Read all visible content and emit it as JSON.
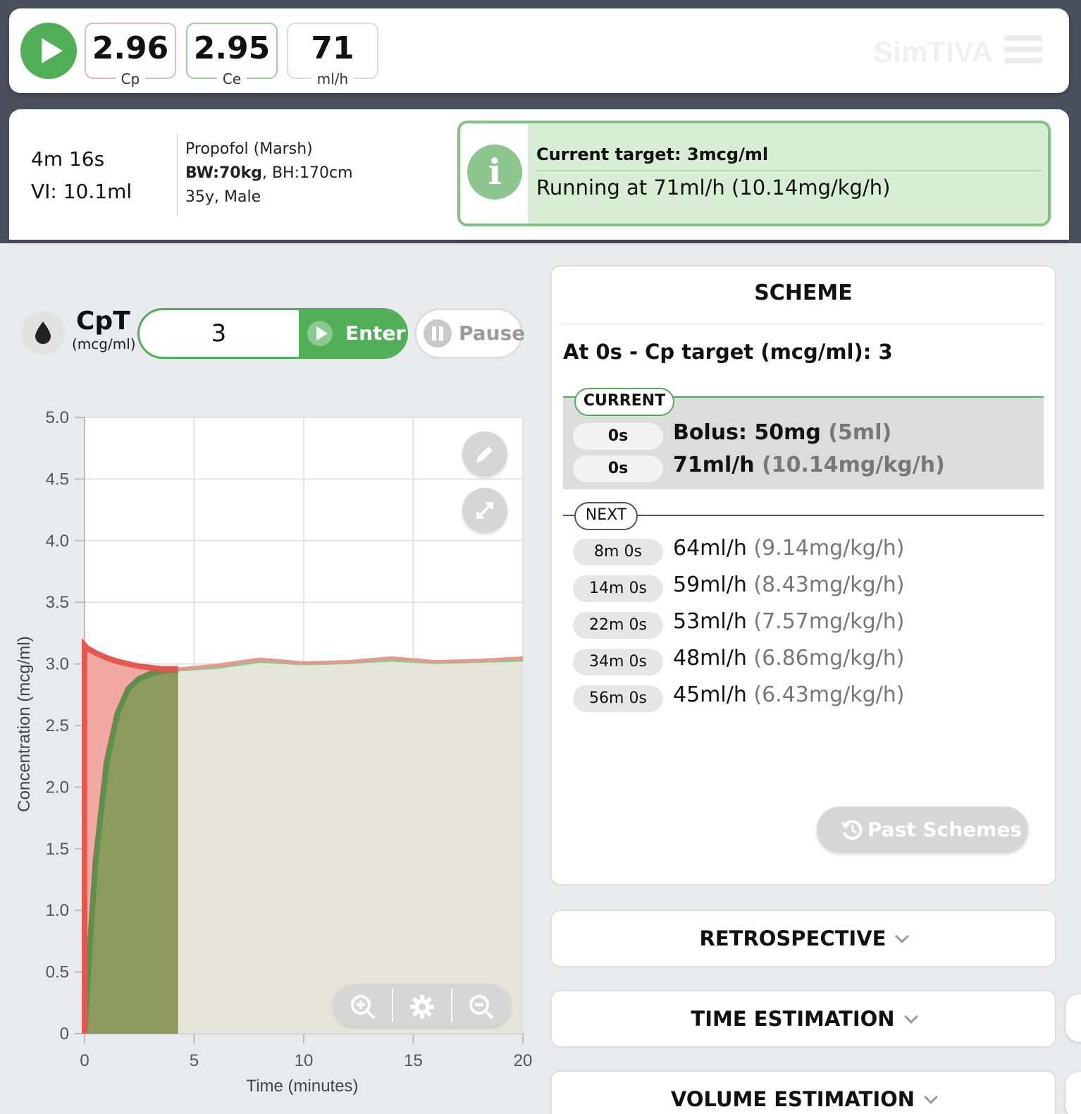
{
  "topbar": {
    "cp": {
      "value": "2.96",
      "unit": "Cp"
    },
    "ce": {
      "value": "2.95",
      "unit": "Ce"
    },
    "rate": {
      "value": "71",
      "unit": "ml/h"
    },
    "brand": "SimTIVA",
    "icons": {
      "play": "play-icon",
      "menu": "hamburger-menu-icon"
    }
  },
  "status": {
    "elapsed": "4m 16s",
    "volume": "VI: 10.1ml",
    "drug": "Propofol (Marsh)",
    "bw": "BW:70kg",
    "bh": ", BH:170cm",
    "demo": "35y, Male"
  },
  "alert": {
    "title": "Current target: 3mcg/ml",
    "message": "Running at 71ml/h (10.14mg/kg/h)",
    "icon": "info-icon",
    "color": "#d7eed4"
  },
  "control": {
    "label": "CpT",
    "unit": "(mcg/ml)",
    "target_value": "3",
    "enter_label": "Enter",
    "pause_label": "Pause",
    "accent": "#4fae56"
  },
  "chart_data": {
    "type": "line",
    "xlabel": "Time (minutes)",
    "ylabel": "Concentration (mcg/ml)",
    "xlim": [
      0,
      20
    ],
    "ylim": [
      0,
      5
    ],
    "xticks": [
      "0",
      "5",
      "10",
      "15",
      "20"
    ],
    "yticks": [
      "0",
      "0.5",
      "1.0",
      "1.5",
      "2.0",
      "2.5",
      "3.0",
      "3.5",
      "4.0",
      "4.5",
      "5.0"
    ],
    "grid": true,
    "current_time_min": 4.27,
    "series": [
      {
        "color": "#e8574e",
        "x": [
          0,
          0.1,
          0.5,
          1,
          1.5,
          2,
          2.5,
          3,
          3.5,
          4,
          4.27,
          6,
          8,
          10,
          12,
          14,
          16,
          18,
          20
        ],
        "y": [
          3.15,
          3.13,
          3.09,
          3.05,
          3.02,
          3.0,
          2.98,
          2.97,
          2.96,
          2.96,
          2.96,
          2.99,
          3.04,
          3.01,
          3.02,
          3.05,
          3.02,
          3.03,
          3.05
        ]
      },
      {
        "color": "#5aa35f",
        "x": [
          0,
          0.2,
          0.5,
          1,
          1.5,
          2,
          2.5,
          3,
          3.5,
          4,
          4.27,
          6,
          8,
          10,
          12,
          14,
          16,
          18,
          20
        ],
        "y": [
          0,
          0.6,
          1.4,
          2.2,
          2.6,
          2.8,
          2.88,
          2.92,
          2.94,
          2.95,
          2.95,
          2.97,
          3.02,
          3.0,
          3.01,
          3.03,
          3.01,
          3.02,
          3.03
        ]
      }
    ]
  },
  "scheme": {
    "title": "SCHEME",
    "subtitle": "At 0s - Cp target (mcg/ml): 3",
    "current_tag": "CURRENT",
    "current": [
      {
        "time": "0s",
        "main": "Bolus: 50mg ",
        "dim": "(5ml)"
      },
      {
        "time": "0s",
        "main": "71ml/h ",
        "dim": "(10.14mg/kg/h)"
      }
    ],
    "next_tag": "NEXT",
    "next": [
      {
        "time": "8m 0s",
        "main": "64ml/h ",
        "dim": "(9.14mg/kg/h)"
      },
      {
        "time": "14m 0s",
        "main": "59ml/h ",
        "dim": "(8.43mg/kg/h)"
      },
      {
        "time": "22m 0s",
        "main": "53ml/h ",
        "dim": "(7.57mg/kg/h)"
      },
      {
        "time": "34m 0s",
        "main": "48ml/h ",
        "dim": "(6.86mg/kg/h)"
      },
      {
        "time": "56m 0s",
        "main": "45ml/h ",
        "dim": "(6.43mg/kg/h)"
      }
    ],
    "past_label": "Past Schemes"
  },
  "sections": {
    "retrospective": "RETROSPECTIVE",
    "time_estimation": "TIME ESTIMATION",
    "volume_estimation": "VOLUME ESTIMATION"
  }
}
